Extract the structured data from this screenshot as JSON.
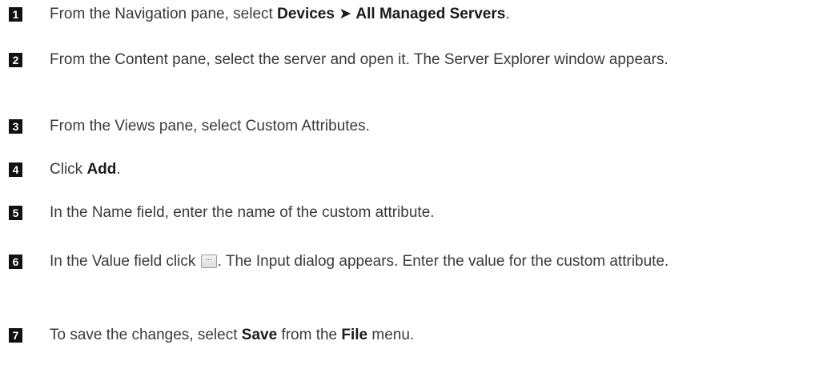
{
  "steps": [
    {
      "number": "1",
      "pre": "From the Navigation pane, select ",
      "bold1": "Devices",
      "arrow": "➤",
      "bold2": "All Managed Servers",
      "post": "."
    },
    {
      "number": "2",
      "text": "From the Content pane, select the server and open it. The Server Explorer window appears."
    },
    {
      "number": "3",
      "text": "From the Views pane, select Custom Attributes."
    },
    {
      "number": "4",
      "pre": "Click ",
      "bold": "Add",
      "post": "."
    },
    {
      "number": "5",
      "text": "In the Name field, enter the name of the custom attribute."
    },
    {
      "number": "6",
      "pre": "In the Value field click ",
      "button_icon": "ellipsis-button-icon",
      "button_glyph": "...",
      "post": ". The Input dialog appears. Enter the value for the custom attribute."
    },
    {
      "number": "7",
      "pre": "To save the changes, select ",
      "bold1": "Save",
      "mid": " from the ",
      "bold2": "File",
      "post": " menu."
    }
  ]
}
